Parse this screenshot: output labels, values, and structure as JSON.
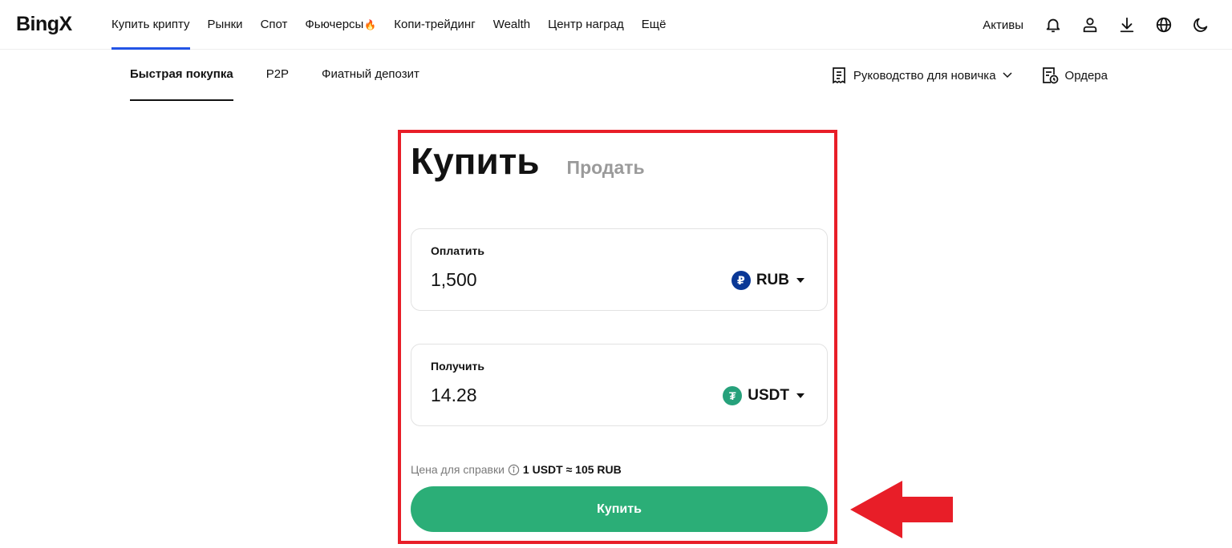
{
  "brand": {
    "name": "BingX"
  },
  "topnav": {
    "links": [
      {
        "label": "Купить крипту"
      },
      {
        "label": "Рынки"
      },
      {
        "label": "Спот"
      },
      {
        "label": "Фьючерсы"
      },
      {
        "label": "Копи-трейдинг"
      },
      {
        "label": "Wealth"
      },
      {
        "label": "Центр наград"
      },
      {
        "label": "Ещё"
      }
    ],
    "fire_icon": "🔥",
    "assets_label": "Активы",
    "icons": [
      "bell-icon",
      "user-icon",
      "download-icon",
      "globe-icon",
      "moon-icon"
    ],
    "accent_color": "#2354e6"
  },
  "subnav": {
    "tabs": [
      {
        "label": "Быстрая покупка"
      },
      {
        "label": "P2P"
      },
      {
        "label": "Фиатный депозит"
      }
    ],
    "guide_label": "Руководство для новичка",
    "orders_label": "Ордера"
  },
  "trade": {
    "buy_tab": "Купить",
    "sell_tab": "Продать",
    "pay": {
      "label": "Оплатить",
      "value": "1,500",
      "currency": "RUB",
      "currency_symbol": "₽",
      "icon_color": "#0a3896"
    },
    "receive": {
      "label": "Получить",
      "value": "14.28",
      "currency": "USDT",
      "currency_symbol": "₮",
      "icon_color": "#26a17b"
    },
    "ref_label": "Цена для справки",
    "ref_rate": "1 USDT ≈ 105 RUB",
    "buy_button": "Купить",
    "button_color": "#2bae77"
  },
  "annotation": {
    "highlight_color": "#e81e28"
  }
}
